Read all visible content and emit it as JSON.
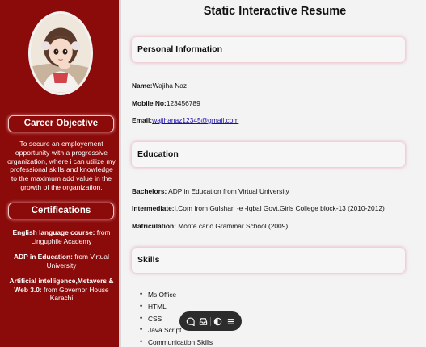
{
  "sidebar": {
    "career_heading": "Career Objective",
    "objective": "To secure an employement opportunity with a progressive organization, where i can utilize my professional skills and knowledge to the maximum add value in the growth of the organization.",
    "cert_heading": "Certifications",
    "certifications": [
      {
        "title": "English language course:",
        "detail": " from Linguphile Academy"
      },
      {
        "title": "ADP in Education:",
        "detail": " from Virtual University"
      },
      {
        "title": "Artificial intelligence,Metavers & Web 3.0:",
        "detail": " from Governor House Karachi"
      }
    ]
  },
  "main": {
    "title": "Static Interactive Resume",
    "personal": {
      "heading": "Personal Information",
      "name_label": "Name:",
      "name_value": "Wajiha Naz",
      "mobile_label": "Mobile No:",
      "mobile_value": "123456789",
      "email_label": "Email:",
      "email_value": "wajihanaz12345@gmail.com"
    },
    "education": {
      "heading": "Education",
      "bachelors_label": "Bachelors:",
      "bachelors_value": " ADP in Education from Virtual University",
      "intermediate_label": "Intermediate:",
      "intermediate_value": "I.Com from Gulshan -e -Iqbal Govt.Girls College block-13 (2010-2012)",
      "matric_label": "Matriculation:",
      "matric_value": " Monte carlo Grammar School (2009)"
    },
    "skills": {
      "heading": "Skills",
      "items": [
        "Ms Office",
        "HTML",
        "CSS",
        "Java Script",
        "Communication Skills"
      ]
    }
  },
  "toolbar": {
    "icons": [
      "comment-icon",
      "inbox-icon",
      "toggle-icon",
      "menu-icon"
    ]
  }
}
